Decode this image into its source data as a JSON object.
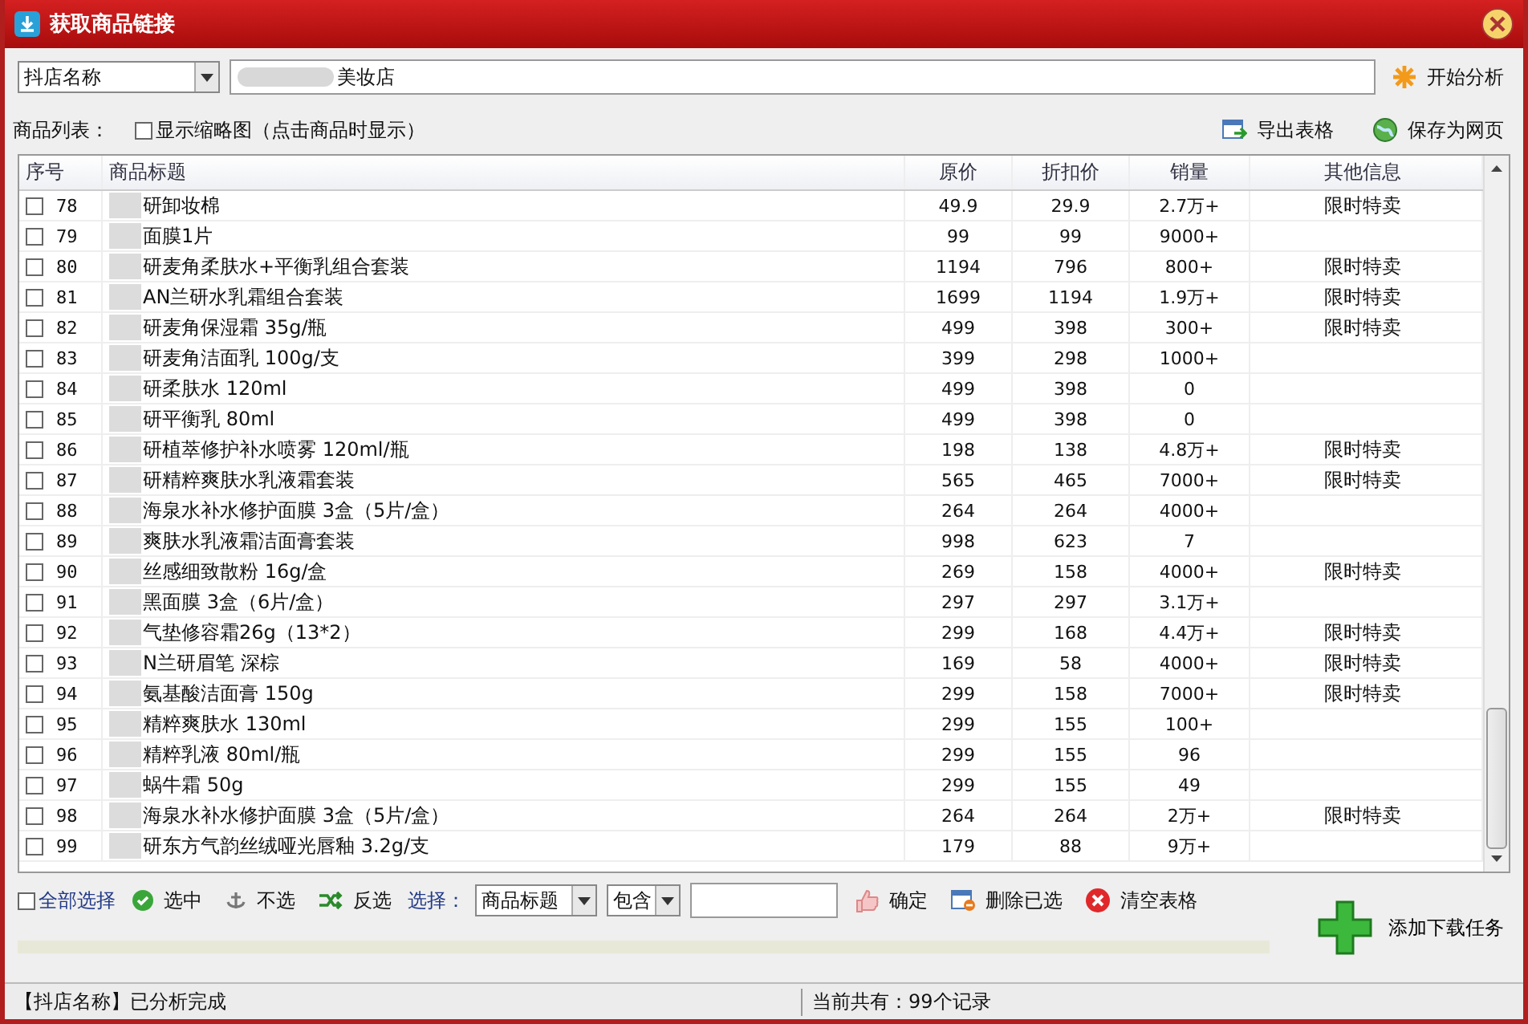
{
  "window": {
    "title": "获取商品链接"
  },
  "shop_select": {
    "value": "抖店名称"
  },
  "shop_field": {
    "value": "美妆店"
  },
  "analyze_button": "开始分析",
  "list_label": "商品列表：",
  "thumbnail_option": {
    "label": "显示缩略图（点击商品时显示）",
    "checked": false
  },
  "export_button": "导出表格",
  "save_button": "保存为网页",
  "table": {
    "columns": [
      "序号",
      "商品标题",
      "原价",
      "折扣价",
      "销量",
      "其他信息"
    ],
    "rows": [
      {
        "checked": false,
        "cells": [
          "78",
          "研卸妆棉",
          "49.9",
          "29.9",
          "2.7万+",
          "限时特卖"
        ]
      },
      {
        "checked": false,
        "cells": [
          "79",
          "面膜1片",
          "99",
          "99",
          "9000+",
          ""
        ]
      },
      {
        "checked": false,
        "cells": [
          "80",
          "研麦角柔肤水+平衡乳组合套装",
          "1194",
          "796",
          "800+",
          "限时特卖"
        ]
      },
      {
        "checked": false,
        "cells": [
          "81",
          "AN兰研水乳霜组合套装",
          "1699",
          "1194",
          "1.9万+",
          "限时特卖"
        ]
      },
      {
        "checked": false,
        "cells": [
          "82",
          "研麦角保湿霜  35g/瓶",
          "499",
          "398",
          "300+",
          "限时特卖"
        ]
      },
      {
        "checked": false,
        "cells": [
          "83",
          "研麦角洁面乳 100g/支",
          "399",
          "298",
          "1000+",
          ""
        ]
      },
      {
        "checked": false,
        "cells": [
          "84",
          "研柔肤水 120ml",
          "499",
          "398",
          "0",
          ""
        ]
      },
      {
        "checked": false,
        "cells": [
          "85",
          "研平衡乳 80ml",
          "499",
          "398",
          "0",
          ""
        ]
      },
      {
        "checked": false,
        "cells": [
          "86",
          "研植萃修护补水喷雾 120ml/瓶",
          "198",
          "138",
          "4.8万+",
          "限时特卖"
        ]
      },
      {
        "checked": false,
        "cells": [
          "87",
          "研精粹爽肤水乳液霜套装",
          "565",
          "465",
          "7000+",
          "限时特卖"
        ]
      },
      {
        "checked": false,
        "cells": [
          "88",
          "海泉水补水修护面膜 3盒（5片/盒）",
          "264",
          "264",
          "4000+",
          ""
        ]
      },
      {
        "checked": false,
        "cells": [
          "89",
          "爽肤水乳液霜洁面膏套装",
          "998",
          "623",
          "7",
          ""
        ]
      },
      {
        "checked": false,
        "cells": [
          "90",
          "丝感细致散粉 16g/盒",
          "269",
          "158",
          "4000+",
          "限时特卖"
        ]
      },
      {
        "checked": false,
        "cells": [
          "91",
          "黑面膜 3盒（6片/盒）",
          "297",
          "297",
          "3.1万+",
          ""
        ]
      },
      {
        "checked": false,
        "cells": [
          "92",
          "气垫修容霜26g（13*2）",
          "299",
          "168",
          "4.4万+",
          "限时特卖"
        ]
      },
      {
        "checked": false,
        "cells": [
          "93",
          "N兰研眉笔 深棕",
          "169",
          "58",
          "4000+",
          "限时特卖"
        ]
      },
      {
        "checked": false,
        "cells": [
          "94",
          "氨基酸洁面膏 150g",
          "299",
          "158",
          "7000+",
          "限时特卖"
        ]
      },
      {
        "checked": false,
        "cells": [
          "95",
          "精粹爽肤水 130ml",
          "299",
          "155",
          "100+",
          ""
        ]
      },
      {
        "checked": false,
        "cells": [
          "96",
          "精粹乳液 80ml/瓶",
          "299",
          "155",
          "96",
          ""
        ]
      },
      {
        "checked": false,
        "cells": [
          "97",
          "蜗牛霜 50g",
          "299",
          "155",
          "49",
          ""
        ]
      },
      {
        "checked": false,
        "cells": [
          "98",
          "海泉水补水修护面膜 3盒（5片/盒）",
          "264",
          "264",
          "2万+",
          "限时特卖"
        ]
      },
      {
        "checked": false,
        "cells": [
          "99",
          "研东方气韵丝绒哑光唇釉 3.2g/支",
          "179",
          "88",
          "9万+",
          ""
        ]
      }
    ]
  },
  "select_all": {
    "label": "全部选择",
    "checked": false
  },
  "actions": [
    {
      "kind": "check",
      "label": "选中"
    },
    {
      "kind": "anchor",
      "label": "不选"
    },
    {
      "kind": "invert",
      "label": "反选"
    }
  ],
  "filter": {
    "label": "选择：",
    "field": "商品标题",
    "mode": "包含",
    "confirm": "确定"
  },
  "delete_button": "删除已选",
  "clear_button": "清空表格",
  "add_task_button": "添加下载任务",
  "progress": {
    "level": 0
  },
  "status_bar": [
    "【抖店名称】已分析完成",
    "当前共有：99个记录"
  ]
}
